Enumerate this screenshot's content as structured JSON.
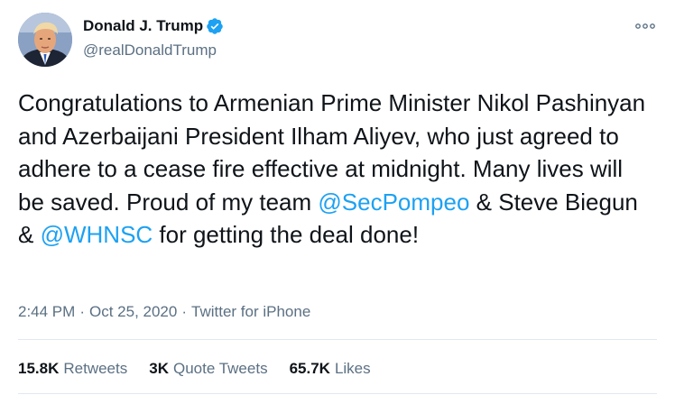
{
  "author": {
    "display_name": "Donald J. Trump",
    "handle": "@realDonaldTrump",
    "verified": true
  },
  "icons": {
    "avatar": "profile-photo",
    "verified": "verified-badge-icon",
    "more": "more-options-icon"
  },
  "colors": {
    "link": "#1da1f2",
    "secondary_text": "#5b7083",
    "primary_text": "#0f1419"
  },
  "tweet": {
    "text_part_1": "Congratulations to Armenian Prime Minister Nikol Pashinyan and Azerbaijani President Ilham Aliyev, who just agreed to adhere to a cease fire effective at midnight. Many lives will be saved. Proud of my team ",
    "mention_1": "@SecPompeo",
    "text_part_2": " & Steve Biegun & ",
    "mention_2": "@WHNSC",
    "text_part_3": " for getting the deal done!"
  },
  "meta": {
    "time": "2:44 PM",
    "separator_1": "·",
    "date": "Oct 25, 2020",
    "separator_2": "·",
    "source": "Twitter for iPhone"
  },
  "stats": {
    "retweets_count": "15.8K",
    "retweets_label": "Retweets",
    "quote_count": "3K",
    "quote_label": "Quote Tweets",
    "likes_count": "65.7K",
    "likes_label": "Likes"
  }
}
